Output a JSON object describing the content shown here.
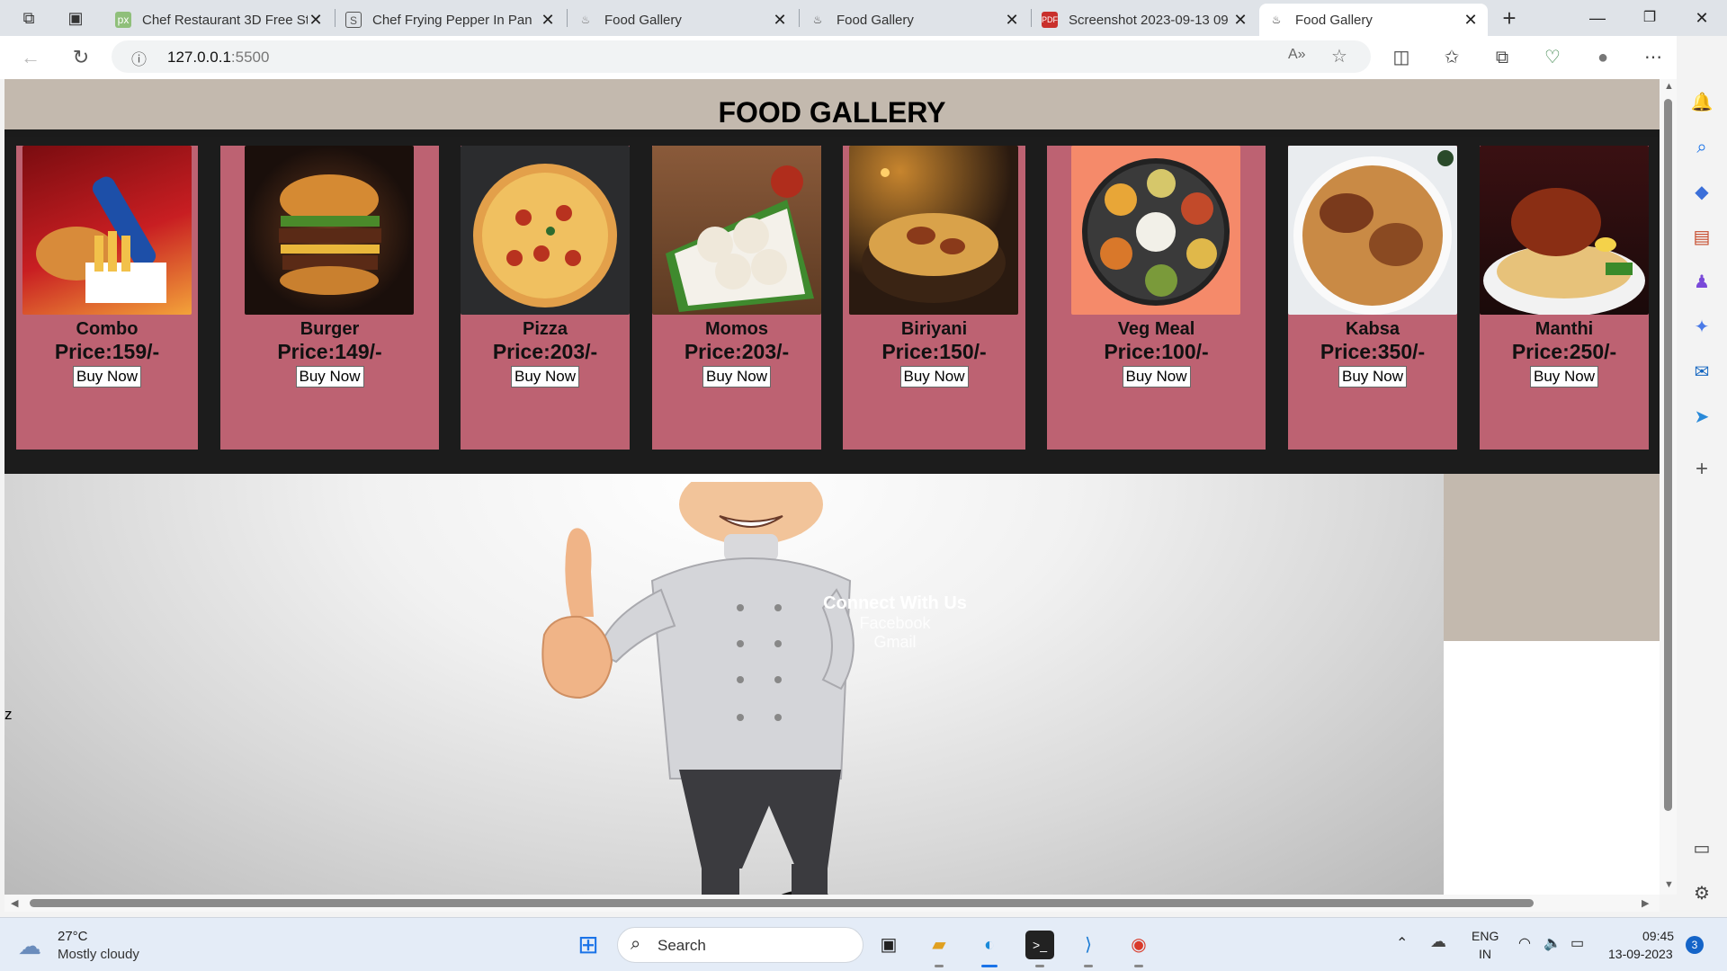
{
  "browser": {
    "tabs": [
      {
        "title": "Chef Restaurant 3D Free St",
        "favicon": "px"
      },
      {
        "title": "Chef Frying Pepper In Pan",
        "favicon": "S"
      },
      {
        "title": "Food Gallery",
        "favicon": "food-icon"
      },
      {
        "title": "Food Gallery",
        "favicon": "food-icon"
      },
      {
        "title": "Screenshot 2023-09-13 09",
        "favicon": "pdf-icon"
      },
      {
        "title": "Food Gallery",
        "favicon": "food-icon"
      }
    ],
    "active_tab": 5,
    "address": {
      "host": "127.0.0.1",
      "port": ":5500"
    }
  },
  "page": {
    "title": "FOOD GALLERY",
    "buy_label": "Buy Now",
    "items": [
      {
        "name": "Combo",
        "price": "Price:159/-"
      },
      {
        "name": "Burger",
        "price": "Price:149/-"
      },
      {
        "name": "Pizza",
        "price": "Price:203/-"
      },
      {
        "name": "Momos",
        "price": "Price:203/-"
      },
      {
        "name": "Biriyani",
        "price": "Price:150/-"
      },
      {
        "name": "Veg Meal",
        "price": "Price:100/-"
      },
      {
        "name": "Kabsa",
        "price": "Price:350/-"
      },
      {
        "name": "Manthi",
        "price": "Price:250/-"
      }
    ],
    "connect": {
      "heading": "Connect With Us",
      "links": [
        "Facebook",
        "Gmail"
      ]
    },
    "stray_text": "z"
  },
  "taskbar": {
    "weather": {
      "temp": "27°C",
      "desc": "Mostly cloudy"
    },
    "search_placeholder": "Search",
    "lang": [
      "ENG",
      "IN"
    ],
    "time": "09:45",
    "date": "13-09-2023",
    "notifications": "3"
  },
  "colors": {
    "header": "#c3b9ae",
    "card": "#bd6272",
    "gallery_bg": "#1c1c1c",
    "accent": "#1464c8"
  }
}
